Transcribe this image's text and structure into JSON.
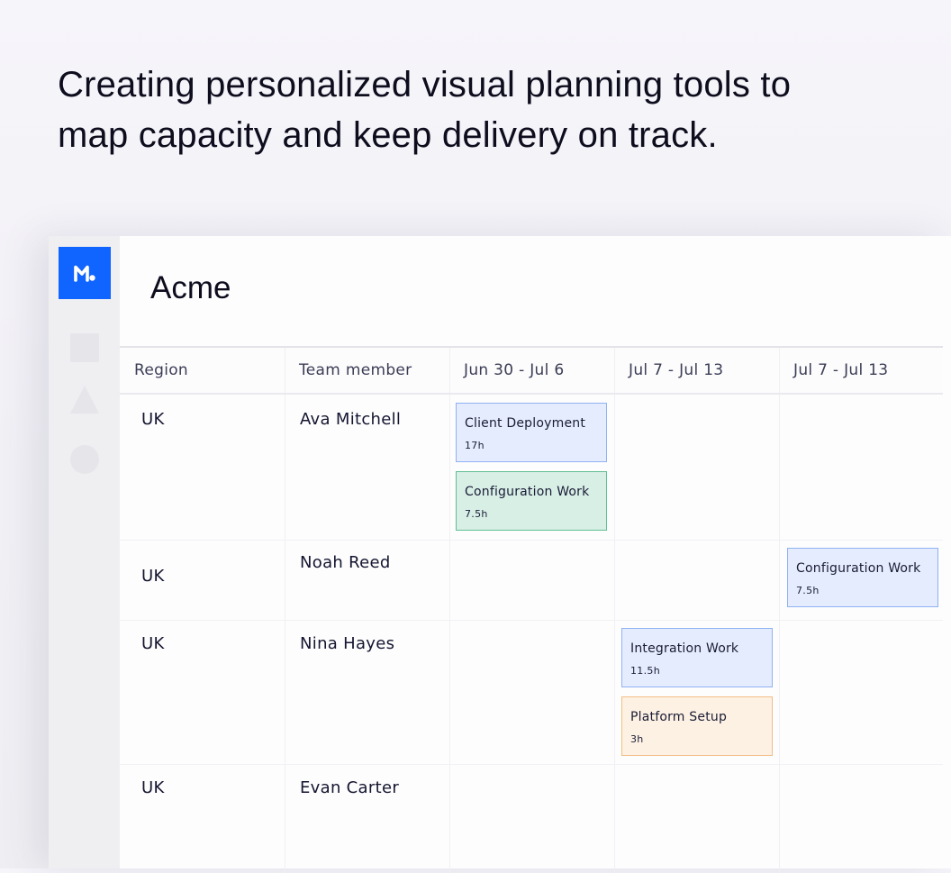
{
  "headline": {
    "line1": "Creating personalized visual planning tools to",
    "line2": "map capacity and keep delivery on track."
  },
  "workspace": {
    "title": "Acme"
  },
  "columns": {
    "region": "Region",
    "member": "Team member",
    "week1": "Jun 30 - Jul 6",
    "week2": "Jul 7 - Jul 13",
    "week3": "Jul 7 - Jul 13"
  },
  "rows": [
    {
      "region": "UK",
      "member": "Ava Mitchell",
      "tasks": [
        {
          "title": "Client Deployment",
          "hours": "17h",
          "week": 1,
          "color": "blue"
        },
        {
          "title": "Configuration Work",
          "hours": "7.5h",
          "week": 1,
          "color": "green"
        }
      ]
    },
    {
      "region": "UK",
      "member": "Noah Reed",
      "tasks": [
        {
          "title": "Configuration Work",
          "hours": "7.5h",
          "week": 3,
          "color": "blue"
        }
      ]
    },
    {
      "region": "UK",
      "member": "Nina Hayes",
      "tasks": [
        {
          "title": "Integration Work",
          "hours": "11.5h",
          "week": 2,
          "color": "blue"
        },
        {
          "title": "Platform Setup",
          "hours": "3h",
          "week": 2,
          "color": "orange"
        }
      ]
    },
    {
      "region": "UK",
      "member": "Evan Carter",
      "tasks": []
    }
  ],
  "colors": {
    "brand": "#1064ff",
    "task_blue_bg": "#e5ecfd",
    "task_blue_border": "#8fb2f2",
    "task_green_bg": "#d8efe6",
    "task_green_border": "#5fbf93",
    "task_orange_bg": "#fdf1e3",
    "task_orange_border": "#f2bc84"
  }
}
